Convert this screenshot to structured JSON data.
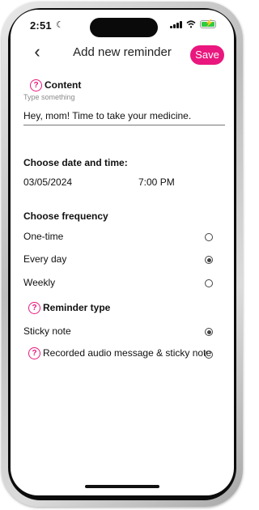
{
  "status": {
    "time": "2:51",
    "moon": "☾"
  },
  "header": {
    "back_icon": "‹",
    "title": "Add new reminder",
    "save_label": "Save"
  },
  "content": {
    "help_icon": "?",
    "title": "Content",
    "placeholder": "Type something",
    "value": "Hey, mom! Time to take your medicine."
  },
  "datetime": {
    "title": "Choose date and time:",
    "date": "03/05/2024",
    "time": "7:00 PM"
  },
  "frequency": {
    "title": "Choose frequency",
    "options": [
      "One-time",
      "Every day",
      "Weekly"
    ],
    "selected": "Every day"
  },
  "reminder_type": {
    "help_icon": "?",
    "title": "Reminder type",
    "options": [
      "Sticky note",
      "Recorded audio message & sticky note"
    ],
    "selected": "Sticky note"
  },
  "colors": {
    "accent": "#e9177e"
  }
}
